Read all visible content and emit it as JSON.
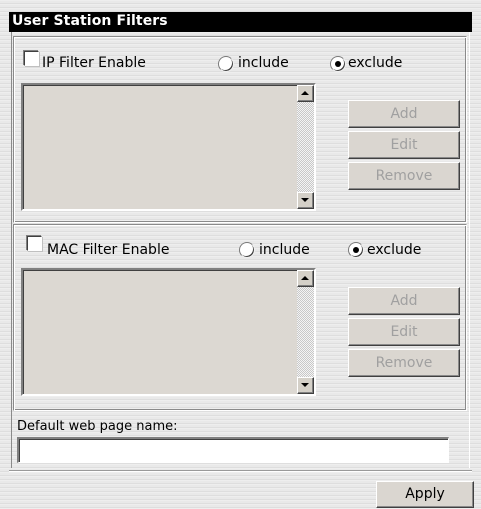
{
  "panel": {
    "title": "User Station Filters"
  },
  "ip_filter": {
    "enable_label": "IP Filter Enable",
    "enabled": false,
    "include_label": "include",
    "exclude_label": "exclude",
    "selected_mode": "exclude",
    "buttons": {
      "add": "Add",
      "edit": "Edit",
      "remove": "Remove"
    }
  },
  "mac_filter": {
    "enable_label": "MAC Filter Enable",
    "enabled": false,
    "include_label": "include",
    "exclude_label": "exclude",
    "selected_mode": "exclude",
    "buttons": {
      "add": "Add",
      "edit": "Edit",
      "remove": "Remove"
    }
  },
  "default_page": {
    "label": "Default web page name:",
    "value": ""
  },
  "footer": {
    "apply_label": "Apply"
  },
  "icons": {
    "scroll_up": "scroll-up-arrow-icon",
    "scroll_down": "scroll-down-arrow-icon"
  },
  "colors": {
    "title_bar": "#000000",
    "title_text": "#ffffff",
    "disabled_text": "#a0a0a0",
    "list_background": "#dcd8d2"
  }
}
